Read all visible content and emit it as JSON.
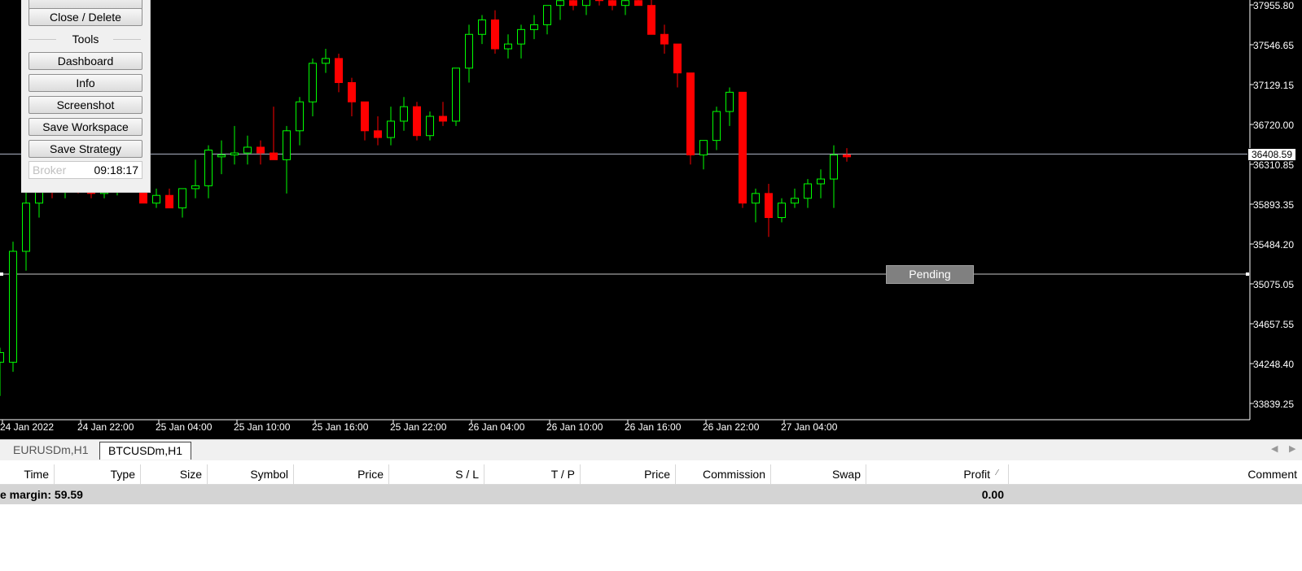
{
  "panel": {
    "close_delete": "Close / Delete",
    "tools_title": "Tools",
    "dashboard": "Dashboard",
    "info": "Info",
    "screenshot": "Screenshot",
    "save_workspace": "Save Workspace",
    "save_strategy": "Save Strategy",
    "broker_label": "Broker",
    "broker_time": "09:18:17"
  },
  "chart": {
    "current_price": "36408.59",
    "pending_label": "Pending",
    "price_axis": [
      "37955.80",
      "37546.65",
      "37129.15",
      "36720.00",
      "36310.85",
      "35893.35",
      "35484.20",
      "35075.05",
      "34657.55",
      "34248.40",
      "33839.25"
    ],
    "time_axis": [
      "24 Jan 2022",
      "24 Jan 22:00",
      "25 Jan 04:00",
      "25 Jan 10:00",
      "25 Jan 16:00",
      "25 Jan 22:00",
      "26 Jan 04:00",
      "26 Jan 10:00",
      "26 Jan 16:00",
      "26 Jan 22:00",
      "27 Jan 04:00"
    ],
    "colors": {
      "bull": "#00ff00",
      "bear": "#ff0000",
      "background": "#000000",
      "grid_line": "#b0b8c8"
    },
    "candles": [
      {
        "o": 34250,
        "h": 34400,
        "l": 33900,
        "c": 34350
      },
      {
        "o": 34250,
        "h": 35500,
        "l": 34150,
        "c": 35400
      },
      {
        "o": 35400,
        "h": 36150,
        "l": 35200,
        "c": 35900
      },
      {
        "o": 35900,
        "h": 36300,
        "l": 35750,
        "c": 36100
      },
      {
        "o": 36100,
        "h": 36300,
        "l": 35950,
        "c": 36050
      },
      {
        "o": 36050,
        "h": 36250,
        "l": 35950,
        "c": 36150
      },
      {
        "o": 36150,
        "h": 36250,
        "l": 36000,
        "c": 36050
      },
      {
        "o": 36050,
        "h": 36150,
        "l": 35950,
        "c": 36000
      },
      {
        "o": 36000,
        "h": 36150,
        "l": 35950,
        "c": 36050
      },
      {
        "o": 36050,
        "h": 36250,
        "l": 35980,
        "c": 36150
      },
      {
        "o": 36150,
        "h": 36200,
        "l": 36050,
        "c": 36050
      },
      {
        "o": 36050,
        "h": 36400,
        "l": 35900,
        "c": 35900
      },
      {
        "o": 35900,
        "h": 36050,
        "l": 35850,
        "c": 35980
      },
      {
        "o": 35980,
        "h": 36050,
        "l": 35850,
        "c": 35850
      },
      {
        "o": 35850,
        "h": 36000,
        "l": 35750,
        "c": 36050
      },
      {
        "o": 36050,
        "h": 36350,
        "l": 35950,
        "c": 36080
      },
      {
        "o": 36080,
        "h": 36500,
        "l": 35950,
        "c": 36450
      },
      {
        "o": 36380,
        "h": 36550,
        "l": 36200,
        "c": 36400
      },
      {
        "o": 36400,
        "h": 36700,
        "l": 36300,
        "c": 36420
      },
      {
        "o": 36420,
        "h": 36600,
        "l": 36300,
        "c": 36480
      },
      {
        "o": 36480,
        "h": 36550,
        "l": 36300,
        "c": 36420
      },
      {
        "o": 36420,
        "h": 36900,
        "l": 36350,
        "c": 36350
      },
      {
        "o": 36350,
        "h": 36700,
        "l": 36000,
        "c": 36650
      },
      {
        "o": 36650,
        "h": 37000,
        "l": 36500,
        "c": 36950
      },
      {
        "o": 36950,
        "h": 37400,
        "l": 36800,
        "c": 37350
      },
      {
        "o": 37350,
        "h": 37500,
        "l": 37250,
        "c": 37400
      },
      {
        "o": 37400,
        "h": 37450,
        "l": 37050,
        "c": 37150
      },
      {
        "o": 37150,
        "h": 37200,
        "l": 36800,
        "c": 36950
      },
      {
        "o": 36950,
        "h": 36950,
        "l": 36550,
        "c": 36650
      },
      {
        "o": 36650,
        "h": 36800,
        "l": 36500,
        "c": 36580
      },
      {
        "o": 36580,
        "h": 36900,
        "l": 36500,
        "c": 36750
      },
      {
        "o": 36750,
        "h": 37000,
        "l": 36650,
        "c": 36900
      },
      {
        "o": 36900,
        "h": 36950,
        "l": 36550,
        "c": 36600
      },
      {
        "o": 36600,
        "h": 36850,
        "l": 36550,
        "c": 36800
      },
      {
        "o": 36800,
        "h": 36950,
        "l": 36700,
        "c": 36750
      },
      {
        "o": 36750,
        "h": 37100,
        "l": 36700,
        "c": 37300
      },
      {
        "o": 37300,
        "h": 37750,
        "l": 37150,
        "c": 37650
      },
      {
        "o": 37650,
        "h": 37850,
        "l": 37550,
        "c": 37800
      },
      {
        "o": 37800,
        "h": 37900,
        "l": 37450,
        "c": 37500
      },
      {
        "o": 37500,
        "h": 37650,
        "l": 37400,
        "c": 37550
      },
      {
        "o": 37550,
        "h": 37750,
        "l": 37400,
        "c": 37700
      },
      {
        "o": 37700,
        "h": 37850,
        "l": 37600,
        "c": 37750
      },
      {
        "o": 37750,
        "h": 37950,
        "l": 37650,
        "c": 37950
      },
      {
        "o": 37950,
        "h": 38100,
        "l": 37800,
        "c": 38000
      },
      {
        "o": 38000,
        "h": 38050,
        "l": 37900,
        "c": 37950
      },
      {
        "o": 37950,
        "h": 38100,
        "l": 37850,
        "c": 38050
      },
      {
        "o": 38050,
        "h": 38100,
        "l": 37950,
        "c": 38000
      },
      {
        "o": 38000,
        "h": 38050,
        "l": 37900,
        "c": 37950
      },
      {
        "o": 37950,
        "h": 38050,
        "l": 37850,
        "c": 38000
      },
      {
        "o": 38000,
        "h": 38050,
        "l": 37950,
        "c": 37950
      },
      {
        "o": 37950,
        "h": 38050,
        "l": 37750,
        "c": 37650
      },
      {
        "o": 37650,
        "h": 37750,
        "l": 37450,
        "c": 37550
      },
      {
        "o": 37550,
        "h": 37550,
        "l": 37100,
        "c": 37250
      },
      {
        "o": 37250,
        "h": 37100,
        "l": 36300,
        "c": 36400
      },
      {
        "o": 36400,
        "h": 36550,
        "l": 36250,
        "c": 36550
      },
      {
        "o": 36550,
        "h": 36900,
        "l": 36450,
        "c": 36850
      },
      {
        "o": 36850,
        "h": 37100,
        "l": 36700,
        "c": 37050
      },
      {
        "o": 37050,
        "h": 37050,
        "l": 35850,
        "c": 35900
      },
      {
        "o": 35900,
        "h": 36050,
        "l": 35700,
        "c": 36000
      },
      {
        "o": 36000,
        "h": 36100,
        "l": 35550,
        "c": 35750
      },
      {
        "o": 35750,
        "h": 35950,
        "l": 35700,
        "c": 35900
      },
      {
        "o": 35900,
        "h": 36050,
        "l": 35850,
        "c": 35950
      },
      {
        "o": 35950,
        "h": 36150,
        "l": 35850,
        "c": 36100
      },
      {
        "o": 36100,
        "h": 36250,
        "l": 35950,
        "c": 36150
      },
      {
        "o": 36150,
        "h": 36500,
        "l": 35850,
        "c": 36400
      },
      {
        "o": 36400,
        "h": 36470,
        "l": 36330,
        "c": 36380
      }
    ]
  },
  "tabs": {
    "eurusd": "EURUSDm,H1",
    "btcusd": "BTCUSDm,H1"
  },
  "table": {
    "headers": [
      "Time",
      "Type",
      "Size",
      "Symbol",
      "Price",
      "S / L",
      "T / P",
      "Price",
      "Commission",
      "Swap",
      "Profit",
      "Comment"
    ],
    "summary_label": "e margin: 59.59",
    "summary_profit": "0.00"
  }
}
